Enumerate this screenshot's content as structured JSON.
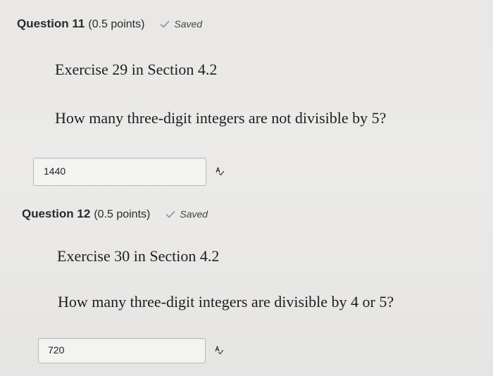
{
  "questions": [
    {
      "number_label": "Question 11",
      "points_label": "(0.5 points)",
      "status": "Saved",
      "exercise": "Exercise 29 in Section 4.2",
      "prompt": "How many three-digit integers are not divisible by 5?",
      "answer": "1440"
    },
    {
      "number_label": "Question 12",
      "points_label": "(0.5 points)",
      "status": "Saved",
      "exercise": "Exercise 30 in Section 4.2",
      "prompt": "How many three-digit integers are divisible by 4 or 5?",
      "answer": "720"
    }
  ],
  "icons": {
    "saved": "check-icon",
    "spellcheck": "spellcheck-icon"
  },
  "colors": {
    "check": "#8a8f95",
    "background": "#e9e8e6",
    "field_border": "#b9b9b7"
  }
}
